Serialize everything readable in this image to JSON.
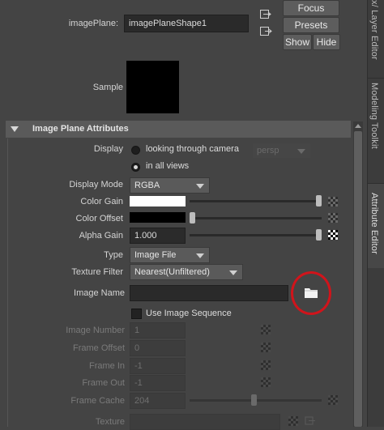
{
  "header": {
    "image_plane_label": "imagePlane:",
    "image_plane_value": "imagePlaneShape1",
    "focus_label": "Focus",
    "presets_label": "Presets",
    "show_label": "Show",
    "hide_label": "Hide",
    "sample_label": "Sample"
  },
  "section": {
    "title": "Image Plane Attributes"
  },
  "attrs": {
    "display_label": "Display",
    "display_option_1": "looking through camera",
    "display_camera": "persp",
    "display_option_2": "in all views",
    "display_mode_label": "Display Mode",
    "display_mode_value": "RGBA",
    "color_gain_label": "Color Gain",
    "color_offset_label": "Color Offset",
    "alpha_gain_label": "Alpha Gain",
    "alpha_gain_value": "1.000",
    "type_label": "Type",
    "type_value": "Image File",
    "texture_filter_label": "Texture Filter",
    "texture_filter_value": "Nearest(Unfiltered)",
    "image_name_label": "Image Name",
    "image_name_value": "",
    "use_image_sequence_label": "Use Image Sequence",
    "image_number_label": "Image Number",
    "image_number_value": "1",
    "frame_offset_label": "Frame Offset",
    "frame_offset_value": "0",
    "frame_in_label": "Frame In",
    "frame_in_value": "-1",
    "frame_out_label": "Frame Out",
    "frame_out_value": "-1",
    "frame_cache_label": "Frame Cache",
    "frame_cache_value": "204",
    "texture_label": "Texture"
  },
  "levels": {
    "color_gain": 1.0,
    "color_offset": 0.0,
    "alpha_gain": 1.0,
    "frame_cache": 0.49
  },
  "side_tabs": {
    "tab_1": "x/ Layer Editor",
    "tab_2": "Modeling Toolkit",
    "tab_3": "Attribute Editor"
  },
  "colors": {
    "highlight_circle": "#d0141b",
    "color_gain_swatch": "#ffffff",
    "color_offset_swatch": "#000000"
  }
}
